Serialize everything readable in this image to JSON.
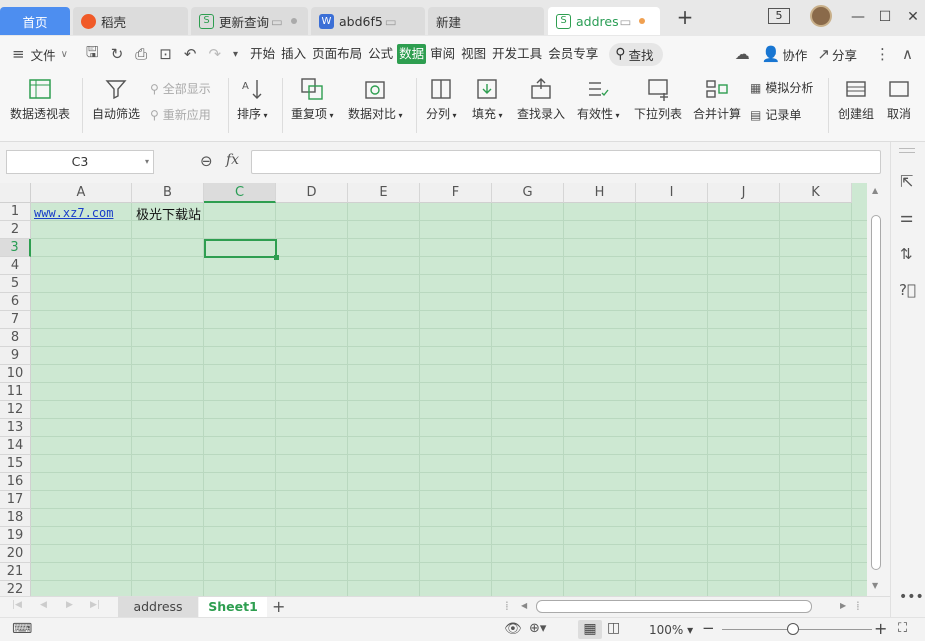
{
  "tabs": [
    {
      "label": "首页"
    },
    {
      "label": "稻壳"
    },
    {
      "label": "更新查询"
    },
    {
      "label": "abd6f5"
    },
    {
      "label": "新建"
    },
    {
      "label": "addres"
    }
  ],
  "window": {
    "badge": "5"
  },
  "menu": {
    "file": "文件",
    "tabs": [
      "开始",
      "插入",
      "页面布局",
      "公式",
      "数据",
      "审阅",
      "视图",
      "开发工具",
      "会员专享"
    ],
    "search": "查找",
    "collab": "协作",
    "share": "分享"
  },
  "ribbon": {
    "pivot": "数据透视表",
    "autofilter": "自动筛选",
    "showall": "全部显示",
    "reapply": "重新应用",
    "sort": "排序",
    "duplicates": "重复项",
    "compare": "数据对比",
    "split": "分列",
    "fill": "填充",
    "lookup": "查找录入",
    "validity": "有效性",
    "dropdown": "下拉列表",
    "consolidate": "合并计算",
    "whatif": "模拟分析",
    "form": "记录单",
    "group": "创建组",
    "ungroup": "取消"
  },
  "formula": {
    "cell_ref": "C3",
    "fx": "fx",
    "content": ""
  },
  "columns": [
    "A",
    "B",
    "C",
    "D",
    "E",
    "F",
    "G",
    "H",
    "I",
    "J",
    "K"
  ],
  "rows": [
    "1",
    "2",
    "3",
    "4",
    "5",
    "6",
    "7",
    "8",
    "9",
    "10",
    "11",
    "12",
    "13",
    "14",
    "15",
    "16",
    "17",
    "18",
    "19",
    "20",
    "21",
    "22"
  ],
  "cells": {
    "A1": "www.xz7.com",
    "B1": "极光下载站"
  },
  "selected": {
    "col": "C",
    "row": "3"
  },
  "sheets": [
    {
      "label": "address"
    },
    {
      "label": "Sheet1"
    }
  ],
  "status": {
    "zoom": "100%"
  },
  "colors": {
    "accent": "#2e9e50",
    "home_tab": "#4d8ef0",
    "grid_bg": "#cde8d2"
  }
}
